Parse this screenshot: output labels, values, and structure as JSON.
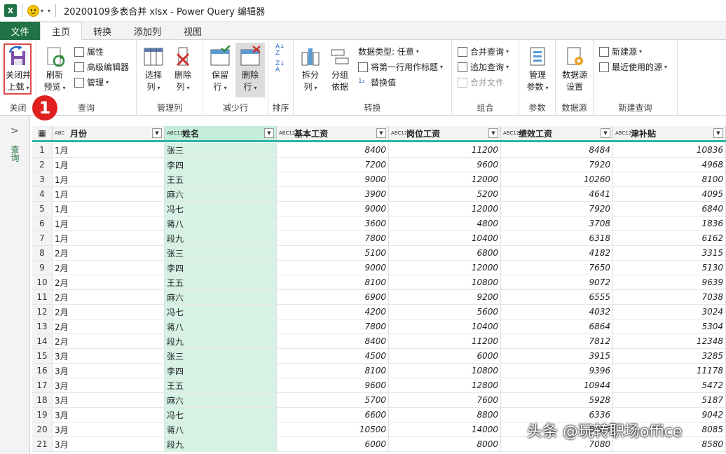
{
  "window": {
    "app_icon": "X",
    "title": "20200109多表合并 xlsx - Power Query 编辑器",
    "qat_arrow": "▾"
  },
  "tabs": [
    {
      "label": "文件"
    },
    {
      "label": "主页"
    },
    {
      "label": "转换"
    },
    {
      "label": "添加列"
    },
    {
      "label": "视图"
    }
  ],
  "ribbon": {
    "close": {
      "btn": "关闭并",
      "btn2": "上载",
      "group": "关闭"
    },
    "query": {
      "refresh": "刷新",
      "refresh2": "预览",
      "props": "属性",
      "adv": "高级编辑器",
      "manage": "管理",
      "group": "查询"
    },
    "cols": {
      "choose": "选择",
      "choose2": "列",
      "remove": "删除",
      "remove2": "列",
      "group": "管理列"
    },
    "rows": {
      "keep": "保留",
      "keep2": "行",
      "remove": "删除",
      "remove2": "行",
      "group": "减少行"
    },
    "sort": {
      "group": "排序"
    },
    "transform": {
      "split": "拆分",
      "split2": "列",
      "groupby": "分组",
      "groupby2": "依据",
      "dtype": "数据类型: 任意",
      "header": "将第一行用作标题",
      "replace": "替换值",
      "group": "转换"
    },
    "combine": {
      "merge": "合并查询",
      "append": "追加查询",
      "files": "合并文件",
      "group": "组合"
    },
    "params": {
      "manage": "管理",
      "manage2": "参数",
      "group": "参数"
    },
    "source": {
      "settings": "数据源",
      "settings2": "设置",
      "group": "数据源"
    },
    "newq": {
      "new": "新建源",
      "recent": "最近使用的源",
      "group": "新建查询"
    }
  },
  "badge": "1",
  "query_pane": {
    "label": "查询"
  },
  "columns": [
    {
      "name": "月份",
      "type": "ABC"
    },
    {
      "name": "姓名",
      "type": "ABC123"
    },
    {
      "name": "基本工资",
      "type": "ABC123"
    },
    {
      "name": "岗位工资",
      "type": "ABC123"
    },
    {
      "name": "绩效工资",
      "type": "ABC123"
    },
    {
      "name": "津补贴",
      "type": "ABC123"
    }
  ],
  "rows": [
    [
      "1",
      "1月",
      "张三",
      "8400",
      "11200",
      "8484",
      "10836"
    ],
    [
      "2",
      "1月",
      "李四",
      "7200",
      "9600",
      "7920",
      "4968"
    ],
    [
      "3",
      "1月",
      "王五",
      "9000",
      "12000",
      "10260",
      "8100"
    ],
    [
      "4",
      "1月",
      "麻六",
      "3900",
      "5200",
      "4641",
      "4095"
    ],
    [
      "5",
      "1月",
      "冯七",
      "9000",
      "12000",
      "7920",
      "6840"
    ],
    [
      "6",
      "1月",
      "蒋八",
      "3600",
      "4800",
      "3708",
      "1836"
    ],
    [
      "7",
      "1月",
      "段九",
      "7800",
      "10400",
      "6318",
      "6162"
    ],
    [
      "8",
      "2月",
      "张三",
      "5100",
      "6800",
      "4182",
      "3315"
    ],
    [
      "9",
      "2月",
      "李四",
      "9000",
      "12000",
      "7650",
      "5130"
    ],
    [
      "10",
      "2月",
      "王五",
      "8100",
      "10800",
      "9072",
      "9639"
    ],
    [
      "11",
      "2月",
      "麻六",
      "6900",
      "9200",
      "6555",
      "7038"
    ],
    [
      "12",
      "2月",
      "冯七",
      "4200",
      "5600",
      "4032",
      "3024"
    ],
    [
      "13",
      "2月",
      "蒋八",
      "7800",
      "10400",
      "6864",
      "5304"
    ],
    [
      "14",
      "2月",
      "段九",
      "8400",
      "11200",
      "7812",
      "12348"
    ],
    [
      "15",
      "3月",
      "张三",
      "4500",
      "6000",
      "3915",
      "3285"
    ],
    [
      "16",
      "3月",
      "李四",
      "8100",
      "10800",
      "9396",
      "11178"
    ],
    [
      "17",
      "3月",
      "王五",
      "9600",
      "12800",
      "10944",
      "5472"
    ],
    [
      "18",
      "3月",
      "麻六",
      "5700",
      "7600",
      "5928",
      "5187"
    ],
    [
      "19",
      "3月",
      "冯七",
      "6600",
      "8800",
      "6336",
      "9042"
    ],
    [
      "20",
      "3月",
      "蒋八",
      "10500",
      "14000",
      "8085",
      "8085"
    ],
    [
      "21",
      "3月",
      "段九",
      "6000",
      "8000",
      "7080",
      "8580"
    ]
  ],
  "watermark": "头条 @玩转职场office"
}
